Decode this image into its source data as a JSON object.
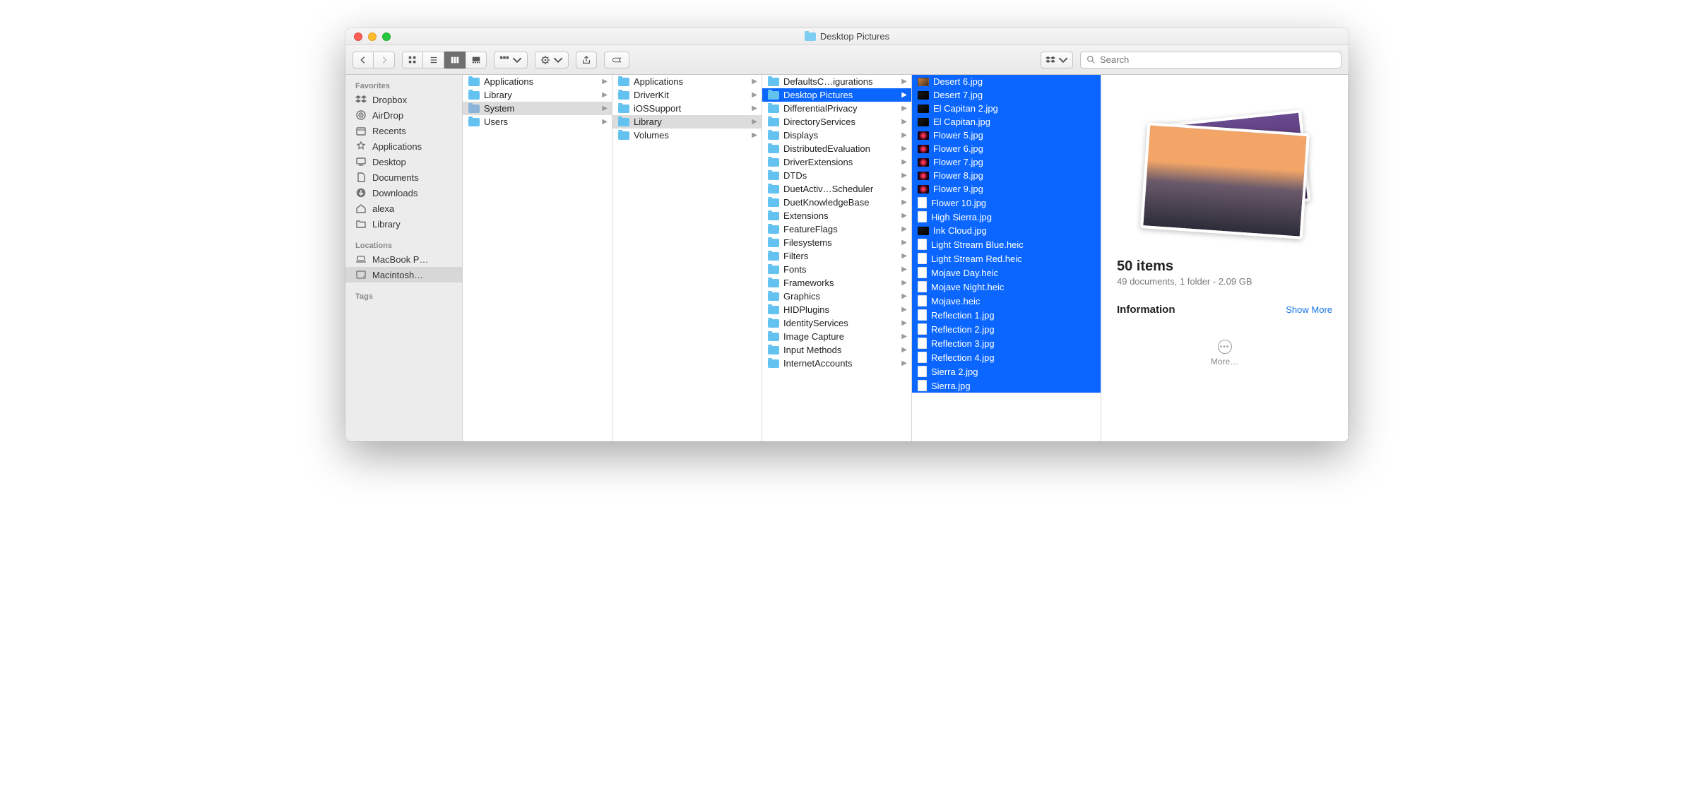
{
  "window": {
    "title": "Desktop Pictures"
  },
  "search": {
    "placeholder": "Search"
  },
  "sidebar": {
    "favorites_label": "Favorites",
    "favorites": [
      {
        "label": "Dropbox",
        "icon": "dropbox"
      },
      {
        "label": "AirDrop",
        "icon": "airdrop"
      },
      {
        "label": "Recents",
        "icon": "recents"
      },
      {
        "label": "Applications",
        "icon": "applications"
      },
      {
        "label": "Desktop",
        "icon": "desktop"
      },
      {
        "label": "Documents",
        "icon": "documents"
      },
      {
        "label": "Downloads",
        "icon": "downloads"
      },
      {
        "label": "alexa",
        "icon": "home"
      },
      {
        "label": "Library",
        "icon": "folder"
      }
    ],
    "locations_label": "Locations",
    "locations": [
      {
        "label": "MacBook P…",
        "icon": "laptop"
      },
      {
        "label": "Macintosh…",
        "icon": "disk",
        "selected": true
      }
    ],
    "tags_label": "Tags"
  },
  "col1": [
    {
      "label": "Applications",
      "type": "folder"
    },
    {
      "label": "Library",
      "type": "folder"
    },
    {
      "label": "System",
      "type": "folder-sys",
      "selected": true
    },
    {
      "label": "Users",
      "type": "folder"
    }
  ],
  "col2": [
    {
      "label": "Applications",
      "type": "folder"
    },
    {
      "label": "DriverKit",
      "type": "folder"
    },
    {
      "label": "iOSSupport",
      "type": "folder"
    },
    {
      "label": "Library",
      "type": "folder",
      "selected": true
    },
    {
      "label": "Volumes",
      "type": "folder"
    }
  ],
  "col3": [
    {
      "label": "DefaultsC…igurations",
      "type": "folder"
    },
    {
      "label": "Desktop Pictures",
      "type": "folder",
      "selected": true
    },
    {
      "label": "DifferentialPrivacy",
      "type": "folder"
    },
    {
      "label": "DirectoryServices",
      "type": "folder"
    },
    {
      "label": "Displays",
      "type": "folder"
    },
    {
      "label": "DistributedEvaluation",
      "type": "folder"
    },
    {
      "label": "DriverExtensions",
      "type": "folder"
    },
    {
      "label": "DTDs",
      "type": "folder"
    },
    {
      "label": "DuetActiv…Scheduler",
      "type": "folder"
    },
    {
      "label": "DuetKnowledgeBase",
      "type": "folder"
    },
    {
      "label": "Extensions",
      "type": "folder"
    },
    {
      "label": "FeatureFlags",
      "type": "folder"
    },
    {
      "label": "Filesystems",
      "type": "folder"
    },
    {
      "label": "Filters",
      "type": "folder"
    },
    {
      "label": "Fonts",
      "type": "folder"
    },
    {
      "label": "Frameworks",
      "type": "folder"
    },
    {
      "label": "Graphics",
      "type": "folder"
    },
    {
      "label": "HIDPlugins",
      "type": "folder"
    },
    {
      "label": "IdentityServices",
      "type": "folder"
    },
    {
      "label": "Image Capture",
      "type": "folder"
    },
    {
      "label": "Input Methods",
      "type": "folder"
    },
    {
      "label": "InternetAccounts",
      "type": "folder"
    }
  ],
  "col4": [
    {
      "label": "Desert 6.jpg",
      "type": "thumb"
    },
    {
      "label": "Desert 7.jpg",
      "type": "thumb-dark"
    },
    {
      "label": "El Capitan 2.jpg",
      "type": "thumb-dark"
    },
    {
      "label": "El Capitan.jpg",
      "type": "thumb-dark"
    },
    {
      "label": "Flower 5.jpg",
      "type": "thumb-flower"
    },
    {
      "label": "Flower 6.jpg",
      "type": "thumb-flower"
    },
    {
      "label": "Flower 7.jpg",
      "type": "thumb-flower"
    },
    {
      "label": "Flower 8.jpg",
      "type": "thumb-flower"
    },
    {
      "label": "Flower 9.jpg",
      "type": "thumb-flower"
    },
    {
      "label": "Flower 10.jpg",
      "type": "file"
    },
    {
      "label": "High Sierra.jpg",
      "type": "file"
    },
    {
      "label": "Ink Cloud.jpg",
      "type": "thumb-dark"
    },
    {
      "label": "Light Stream Blue.heic",
      "type": "file"
    },
    {
      "label": "Light Stream Red.heic",
      "type": "file"
    },
    {
      "label": "Mojave Day.heic",
      "type": "file"
    },
    {
      "label": "Mojave Night.heic",
      "type": "file"
    },
    {
      "label": "Mojave.heic",
      "type": "file"
    },
    {
      "label": "Reflection 1.jpg",
      "type": "file"
    },
    {
      "label": "Reflection 2.jpg",
      "type": "file"
    },
    {
      "label": "Reflection 3.jpg",
      "type": "file"
    },
    {
      "label": "Reflection 4.jpg",
      "type": "file"
    },
    {
      "label": "Sierra 2.jpg",
      "type": "file"
    },
    {
      "label": "Sierra.jpg",
      "type": "file"
    }
  ],
  "preview": {
    "title": "50 items",
    "subtitle": "49 documents, 1 folder - 2.09 GB",
    "info_label": "Information",
    "show_more": "Show More",
    "more_label": "More…"
  }
}
